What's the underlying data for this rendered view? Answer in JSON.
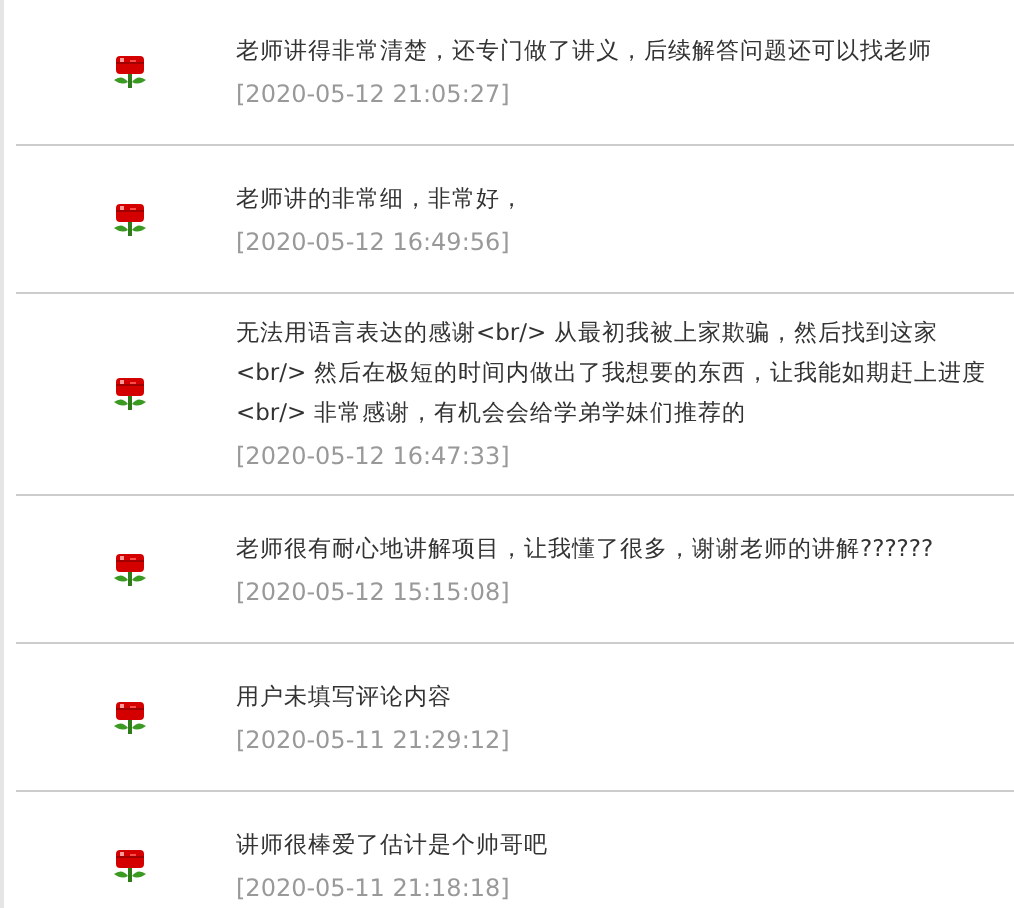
{
  "reviews": [
    {
      "text": "老师讲得非常清楚，还专门做了讲义，后续解答问题还可以找老师",
      "time": "[2020-05-12 21:05:27]"
    },
    {
      "text": "老师讲的非常细，非常好，",
      "time": "[2020-05-12 16:49:56]"
    },
    {
      "text": "无法用语言表达的感谢<br/> 从最初我被上家欺骗，然后找到这家<br/> 然后在极短的时间内做出了我想要的东西，让我能如期赶上进度<br/> 非常感谢，有机会会给学弟学妹们推荐的",
      "time": "[2020-05-12 16:47:33]"
    },
    {
      "text": "老师很有耐心地讲解项目，让我懂了很多，谢谢老师的讲解??????",
      "time": "[2020-05-12 15:15:08]"
    },
    {
      "text": "用户未填写评论内容",
      "time": "[2020-05-11 21:29:12]"
    },
    {
      "text": "讲师很棒爱了估计是个帅哥吧",
      "time": "[2020-05-11 21:18:18]"
    }
  ]
}
